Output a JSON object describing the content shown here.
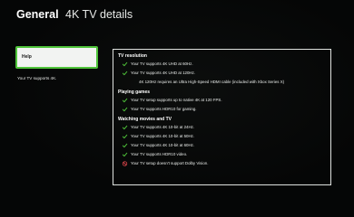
{
  "header": {
    "section": "General",
    "title": "4K TV details"
  },
  "sidebar": {
    "help_label": "Help",
    "status_text": "Your TV supports 4K."
  },
  "panel": {
    "groups": [
      {
        "title": "TV resolution",
        "rows": [
          {
            "icon": "check-icon",
            "text": "Your TV supports 4K UHD at 60Hz."
          },
          {
            "icon": "check-icon",
            "text": "Your TV supports 4K UHD at 120Hz."
          },
          {
            "icon": "none",
            "text": "4K 120Hz requires an Ultra High-Speed HDMI cable (included with Xbox Series X)"
          }
        ]
      },
      {
        "title": "Playing games",
        "rows": [
          {
            "icon": "check-icon",
            "text": "Your TV setup supports up to native 4K at 120 FPS."
          },
          {
            "icon": "check-icon",
            "text": "Your TV supports HDR10 for gaming."
          }
        ]
      },
      {
        "title": "Watching movies and TV",
        "rows": [
          {
            "icon": "check-icon",
            "text": "Your TV supports 4K 10-bit at 24Hz."
          },
          {
            "icon": "check-icon",
            "text": "Your TV supports 4K 10-bit at 50Hz."
          },
          {
            "icon": "check-icon",
            "text": "Your TV supports 4K 10-bit at 60Hz."
          },
          {
            "icon": "check-icon",
            "text": "Your TV supports HDR10 video."
          },
          {
            "icon": "prohibited-icon",
            "text": "Your TV setup doesn't support Dolby Vision."
          }
        ]
      }
    ]
  },
  "colors": {
    "check": "#4fc43a",
    "prohibited": "#e5484d",
    "focus_border": "#4fc43a"
  }
}
